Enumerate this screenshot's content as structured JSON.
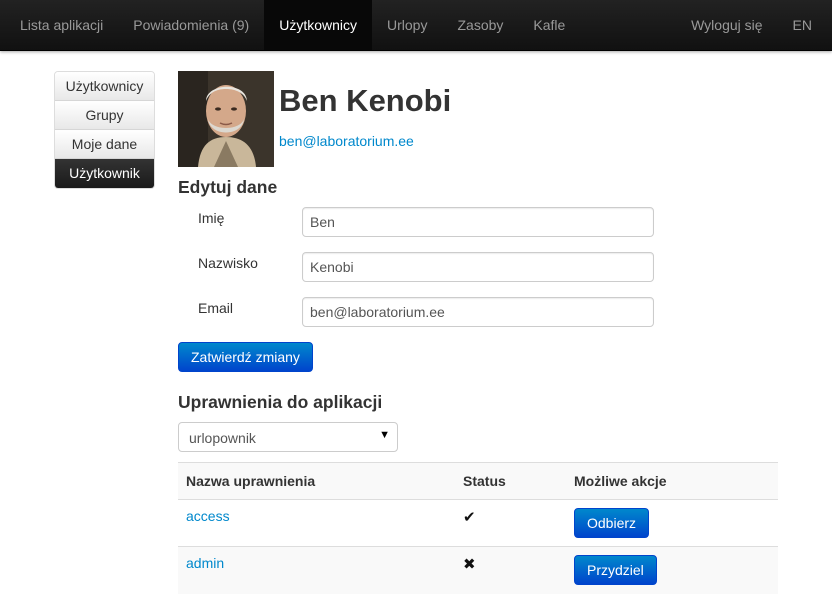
{
  "navbar": {
    "left_items": [
      {
        "label": "Lista aplikacji"
      },
      {
        "label": "Powiadomienia (9)"
      },
      {
        "label": "Użytkownicy"
      },
      {
        "label": "Urlopy"
      },
      {
        "label": "Zasoby"
      },
      {
        "label": "Kafle"
      }
    ],
    "logout_label": "Wyloguj się",
    "lang_label": "EN"
  },
  "sidebar": {
    "items": [
      {
        "label": "Użytkownicy"
      },
      {
        "label": "Grupy"
      },
      {
        "label": "Moje dane"
      },
      {
        "label": "Użytkownik"
      }
    ]
  },
  "profile": {
    "name": "Ben Kenobi",
    "email": "ben@laboratorium.ee"
  },
  "edit_form": {
    "title": "Edytuj dane",
    "first_name_label": "Imię",
    "first_name_value": "Ben",
    "last_name_label": "Nazwisko",
    "last_name_value": "Kenobi",
    "email_label": "Email",
    "email_value": "ben@laboratorium.ee",
    "submit_label": "Zatwierdź zmiany"
  },
  "permissions": {
    "title": "Uprawnienia do aplikacji",
    "selected_app": "urlopownik",
    "headers": {
      "name": "Nazwa uprawnienia",
      "status": "Status",
      "actions": "Możliwe akcje"
    },
    "rows": [
      {
        "name": "access",
        "status_icon": "✔",
        "action_label": "Odbierz"
      },
      {
        "name": "admin",
        "status_icon": "✖",
        "action_label": "Przydziel"
      }
    ]
  },
  "colors": {
    "link": "#0088cc",
    "primary_button": "#0044cc",
    "navbar": "#1b1b1b"
  }
}
